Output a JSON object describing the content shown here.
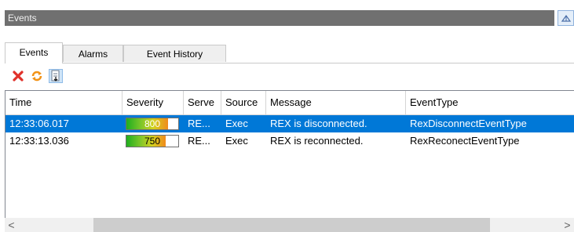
{
  "panel": {
    "title": "Events"
  },
  "tabs": [
    {
      "label": "Events",
      "active": true
    },
    {
      "label": "Alarms",
      "active": false
    },
    {
      "label": "Event History",
      "active": false
    }
  ],
  "toolbar": {
    "buttons": [
      {
        "icon": "delete-icon",
        "color": "#e0312a"
      },
      {
        "icon": "refresh-icon",
        "color": "#f29318"
      },
      {
        "icon": "properties-icon",
        "selected": true
      }
    ]
  },
  "grid": {
    "columns": [
      "Time",
      "Severity",
      "Serve",
      "Source",
      "Message",
      "EventType"
    ],
    "rows": [
      {
        "time": "12:33:06.017",
        "severity": "800",
        "severity_level": 800,
        "server": "RE...",
        "source": "Exec",
        "message": "REX is disconnected.",
        "event_type": "RexDisconnectEventType",
        "selected": true
      },
      {
        "time": "12:33:13.036",
        "severity": "750",
        "severity_level": 750,
        "server": "RE...",
        "source": "Exec",
        "message": "REX is reconnected.",
        "event_type": "RexReconectEventType",
        "selected": false
      }
    ]
  },
  "scrollbar": {
    "left_arrow": "<",
    "right_arrow": ">"
  },
  "colors": {
    "selection": "#0078d7",
    "header_bar": "#707070"
  }
}
